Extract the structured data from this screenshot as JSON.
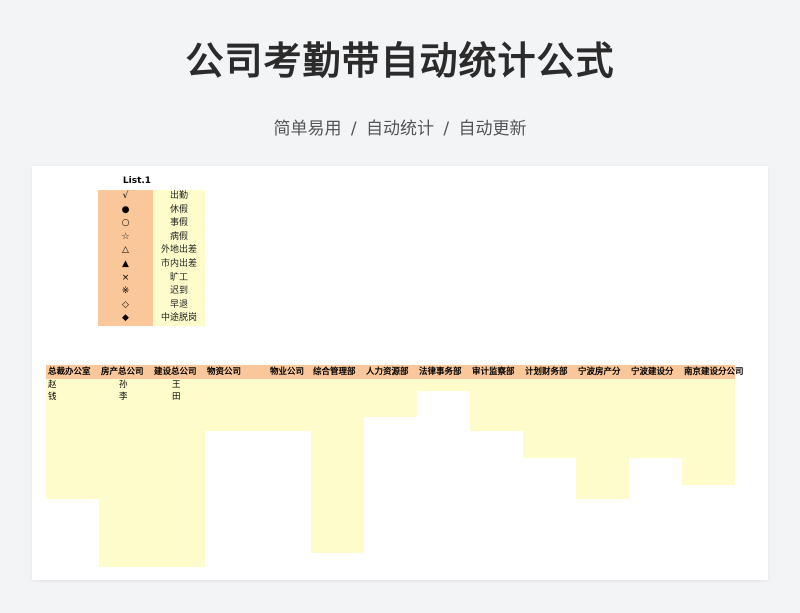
{
  "page": {
    "title": "公司考勤带自动统计公式",
    "subtitle": "简单易用  /  自动统计  /  自动更新"
  },
  "legend": {
    "title": "List.1",
    "items": [
      {
        "symbol": "√",
        "label": "出勤"
      },
      {
        "symbol": "●",
        "label": "休假"
      },
      {
        "symbol": "○",
        "label": "事假"
      },
      {
        "symbol": "☆",
        "label": "病假"
      },
      {
        "symbol": "△",
        "label": "外地出差"
      },
      {
        "symbol": "▲",
        "label": "市内出差"
      },
      {
        "symbol": "×",
        "label": "旷工"
      },
      {
        "symbol": "※",
        "label": "迟到"
      },
      {
        "symbol": "◇",
        "label": "早退"
      },
      {
        "symbol": "◆",
        "label": "中途脱岗"
      }
    ]
  },
  "departments": [
    {
      "name": "总裁办公室",
      "staff": [
        "赵",
        "钱"
      ]
    },
    {
      "name": "房产总公司",
      "staff": [
        "孙",
        "李"
      ]
    },
    {
      "name": "建设总公司",
      "staff": [
        "王",
        "田"
      ]
    },
    {
      "name": "物资公司",
      "staff": []
    },
    {
      "name": "物业公司",
      "staff": []
    },
    {
      "name": "综合管理部",
      "staff": []
    },
    {
      "name": "人力资源部",
      "staff": []
    },
    {
      "name": "法律事务部",
      "staff": []
    },
    {
      "name": "审计监察部",
      "staff": []
    },
    {
      "name": "计划财务部",
      "staff": []
    },
    {
      "name": "宁波房产分",
      "staff": []
    },
    {
      "name": "宁波建设分",
      "staff": []
    },
    {
      "name": "南京建设分公司",
      "staff": []
    }
  ]
}
